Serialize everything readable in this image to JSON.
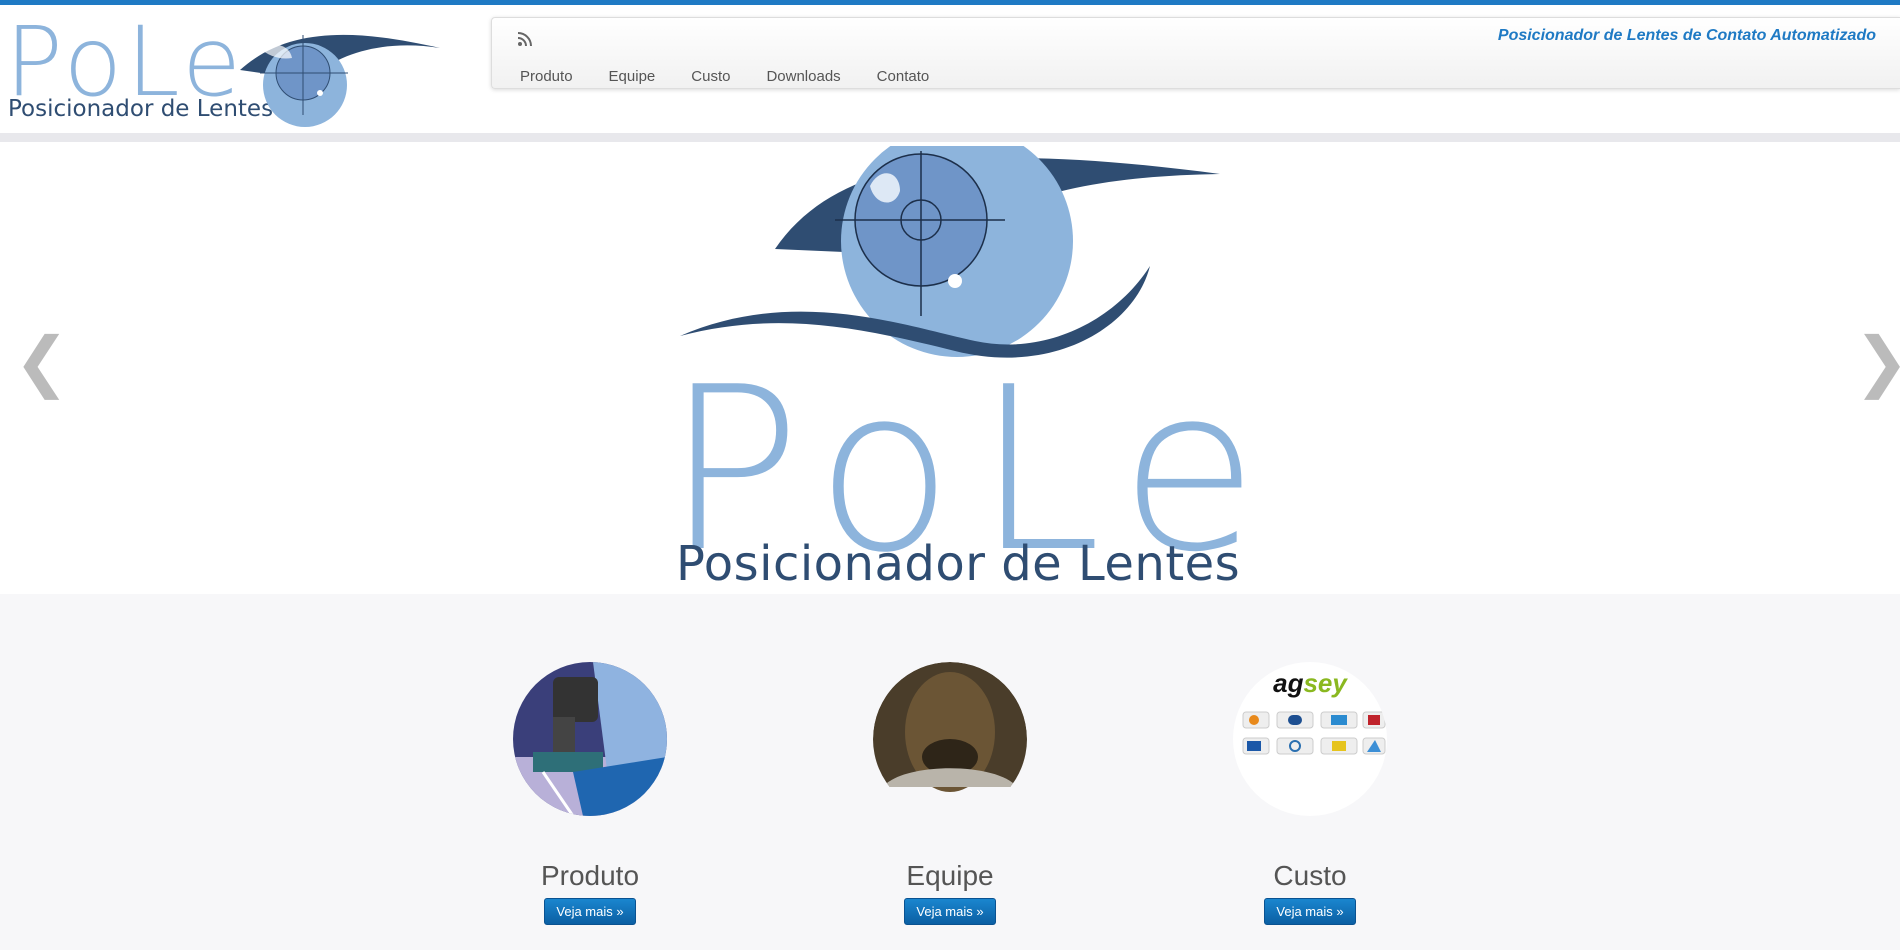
{
  "header": {
    "logo_text": "PoLe",
    "logo_subtitle": "Posicionador de Lentes",
    "tagline": "Posicionador de Lentes de Contato Automatizado",
    "rss_icon": "rss-icon",
    "accent_color": "#1f7ac4"
  },
  "nav": {
    "items": [
      {
        "label": "Produto"
      },
      {
        "label": "Equipe"
      },
      {
        "label": "Custo"
      },
      {
        "label": "Downloads"
      },
      {
        "label": "Contato"
      }
    ]
  },
  "carousel": {
    "logo_text": "PoLe",
    "logo_subtitle": "Posicionador de Lentes",
    "prev_glyph": "❮",
    "next_glyph": "❯"
  },
  "features": [
    {
      "title": "Produto",
      "button": "Veja mais »"
    },
    {
      "title": "Equipe",
      "button": "Veja mais »"
    },
    {
      "title": "Custo",
      "button": "Veja mais »",
      "image_text": "agsey"
    }
  ]
}
